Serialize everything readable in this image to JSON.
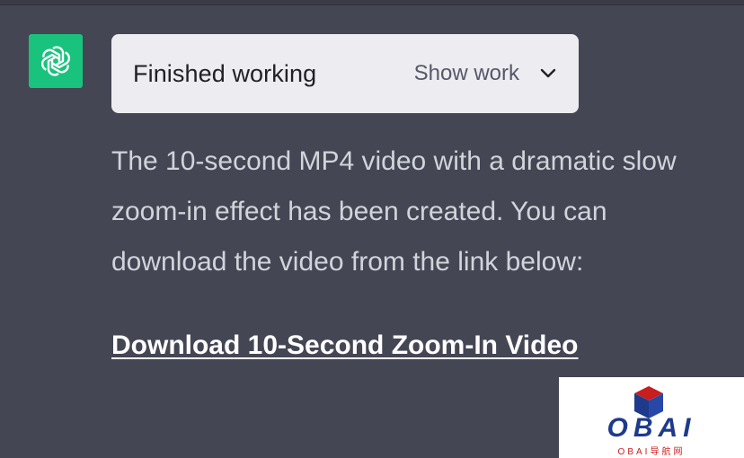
{
  "assistant": {
    "avatar_icon": "openai-logo-icon",
    "avatar_color": "#19c37d"
  },
  "status_card": {
    "title": "Finished working",
    "toggle_label": "Show work",
    "toggle_icon": "chevron-down-icon"
  },
  "message": {
    "text": "The 10-second MP4 video with a dramatic slow zoom-in effect has been created. You can download the video from the link below:",
    "link_label": "Download 10-Second Zoom-In Video"
  },
  "watermark": {
    "brand": "OBAI",
    "subtitle": "OBAI导航网",
    "brand_color": "#1e3a8a",
    "accent_color": "#c81e1e"
  },
  "colors": {
    "background": "#444654",
    "card_background": "#ececf1",
    "text_primary": "#d1d5db",
    "link": "#ffffff"
  }
}
